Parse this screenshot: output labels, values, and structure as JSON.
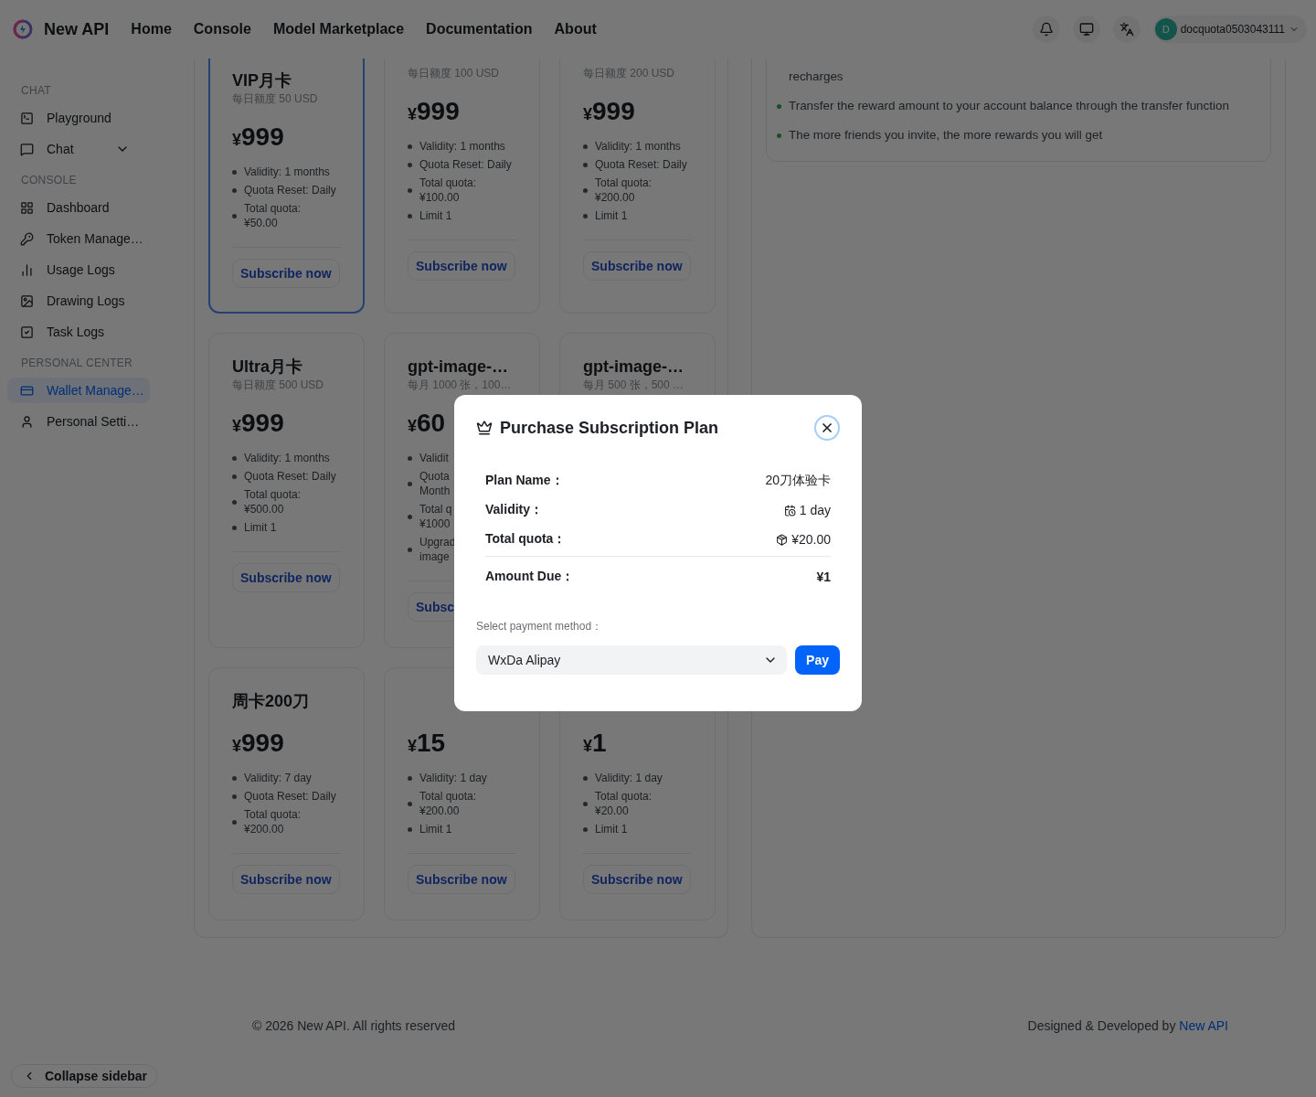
{
  "header": {
    "brand": "New API",
    "nav": [
      "Home",
      "Console",
      "Model Marketplace",
      "Documentation",
      "About"
    ],
    "user": {
      "initial": "D",
      "name": "docquota0503043111"
    }
  },
  "sidebar": {
    "sections": [
      {
        "label": "CHAT",
        "items": [
          {
            "label": "Playground",
            "kind": "link",
            "selected": false
          },
          {
            "label": "Chat",
            "kind": "group",
            "expanded": false,
            "selected": false
          }
        ]
      },
      {
        "label": "CONSOLE",
        "items": [
          {
            "label": "Dashboard",
            "kind": "link",
            "selected": false
          },
          {
            "label": "Token Manage…",
            "kind": "link",
            "selected": false
          },
          {
            "label": "Usage Logs",
            "kind": "link",
            "selected": false
          },
          {
            "label": "Drawing Logs",
            "kind": "link",
            "selected": false
          },
          {
            "label": "Task Logs",
            "kind": "link",
            "selected": false
          }
        ]
      },
      {
        "label": "PERSONAL CENTER",
        "items": [
          {
            "label": "Wallet Manage…",
            "kind": "link",
            "selected": true
          },
          {
            "label": "Personal Setti…",
            "kind": "link",
            "selected": false
          }
        ]
      }
    ],
    "collapse": "Collapse sidebar"
  },
  "plans": [
    {
      "title": "VIP月卡",
      "subtitle": "每日额度 50 USD",
      "currency": "¥",
      "amount": "999",
      "features": [
        "Validity: 1 months",
        "Quota Reset: Daily",
        "Total quota:\n¥50.00"
      ],
      "button": "Subscribe now",
      "selected": true
    },
    {
      "subtitle": "每日额度 100 USD",
      "currency": "¥",
      "amount": "999",
      "features": [
        "Validity: 1 months",
        "Quota Reset: Daily",
        "Total quota:\n¥100.00",
        "Limit 1"
      ],
      "button": "Subscribe now",
      "selected": false
    },
    {
      "subtitle": "每日额度 200 USD",
      "currency": "¥",
      "amount": "999",
      "features": [
        "Validity: 1 months",
        "Quota Reset: Daily",
        "Total quota:\n¥200.00",
        "Limit 1"
      ],
      "button": "Subscribe now",
      "selected": false
    },
    {
      "title": "Ultra月卡",
      "subtitle": "每日额度 500 USD",
      "currency": "¥",
      "amount": "999",
      "features": [
        "Validity: 1 months",
        "Quota Reset: Daily",
        "Total quota:\n¥500.00",
        "Limit 1"
      ],
      "button": "Subscribe now",
      "selected": false
    },
    {
      "title": "gpt-image-…",
      "subtitle": "每月 1000 张，100…",
      "currency": "¥",
      "amount": "60",
      "features": [
        "Validit",
        "Quota\nMonth",
        "Total q\n¥1000",
        "Upgrad\nimage"
      ],
      "button": "Subsc",
      "selected": false
    },
    {
      "title": "gpt-image-…",
      "subtitle": "每月 500 张，500 …",
      "selected": false
    },
    {
      "title": "周卡200刀",
      "currency": "¥",
      "amount": "999",
      "features": [
        "Validity: 7 day",
        "Quota Reset: Daily",
        "Total quota:\n¥200.00"
      ],
      "button": "Subscribe now",
      "selected": false
    },
    {
      "currency": "¥",
      "amount": "15",
      "features": [
        "Validity: 1 day",
        "Total quota:\n¥200.00",
        "Limit 1"
      ],
      "button": "Subscribe now",
      "selected": false
    },
    {
      "currency": "¥",
      "amount": "1",
      "features": [
        "Validity: 1 day",
        "Total quota:\n¥20.00",
        "Limit 1"
      ],
      "button": "Subscribe now",
      "selected": false
    }
  ],
  "rules": [
    {
      "kind": "continuation",
      "text": "recharges"
    },
    {
      "kind": "bullet",
      "text": "Transfer the reward amount to your account balance through the transfer function"
    },
    {
      "kind": "bullet",
      "text": "The more friends you invite, the more rewards you will get"
    }
  ],
  "footer": {
    "copyright": "© 2026 New API. All rights reserved",
    "credit": "Designed & Developed by",
    "link": "New API"
  },
  "modal": {
    "title": "Purchase Subscription Plan",
    "rows": [
      {
        "kind": "name",
        "label": "Plan Name：",
        "value": "20刀体验卡"
      },
      {
        "kind": "validity",
        "label": "Validity：",
        "value": "1 day"
      },
      {
        "kind": "quota",
        "label": "Total quota：",
        "value": "¥20.00"
      }
    ],
    "total": {
      "label": "Amount Due：",
      "value": "¥1"
    },
    "payment_label": "Select payment method：",
    "payment_method": "WxDa Alipay",
    "pay": "Pay"
  }
}
